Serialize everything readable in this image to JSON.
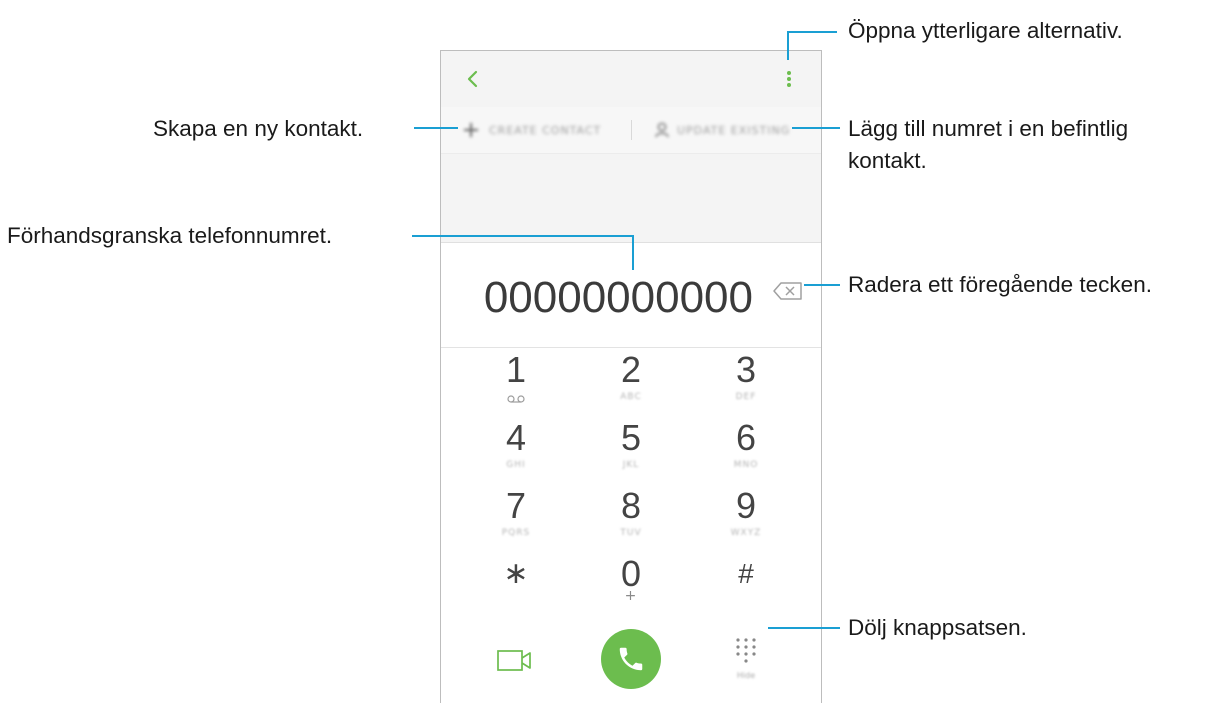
{
  "toolbar": {
    "back_icon": "chevron-left-icon",
    "more_icon": "vertical-dots-icon"
  },
  "actions": {
    "create_label": "CREATE CONTACT",
    "update_label": "UPDATE EXISTING",
    "create_icon": "plus-icon",
    "update_icon": "person-icon"
  },
  "dialer": {
    "number": "00000000000",
    "backspace_icon": "backspace-icon",
    "keys": [
      {
        "digit": "1",
        "sub": "voicemail-icon"
      },
      {
        "digit": "2",
        "sub": "ABC"
      },
      {
        "digit": "3",
        "sub": "DEF"
      },
      {
        "digit": "4",
        "sub": "GHI"
      },
      {
        "digit": "5",
        "sub": "JKL"
      },
      {
        "digit": "6",
        "sub": "MNO"
      },
      {
        "digit": "7",
        "sub": "PQRS"
      },
      {
        "digit": "8",
        "sub": "TUV"
      },
      {
        "digit": "9",
        "sub": "WXYZ"
      },
      {
        "digit": "∗",
        "sub": ""
      },
      {
        "digit": "0",
        "sub": "+"
      },
      {
        "digit": "#",
        "sub": ""
      }
    ],
    "hide_label": "Hide",
    "video_icon": "video-call-icon",
    "call_icon": "phone-icon",
    "hide_icon": "keypad-icon"
  },
  "annotations": {
    "more_options": "Öppna ytterligare alternativ.",
    "create_contact": "Skapa en ny kontakt.",
    "add_to_existing_line1": "Lägg till numret i en befintlig",
    "add_to_existing_line2": "kontakt.",
    "preview_number": "Förhandsgranska telefonnumret.",
    "delete_char": "Radera ett föregående tecken.",
    "hide_keypad": "Dölj knappsatsen."
  },
  "colors": {
    "accent": "#6cbd4e",
    "callout_line": "#1a9fd3",
    "backspace": "#a0a0a0"
  }
}
